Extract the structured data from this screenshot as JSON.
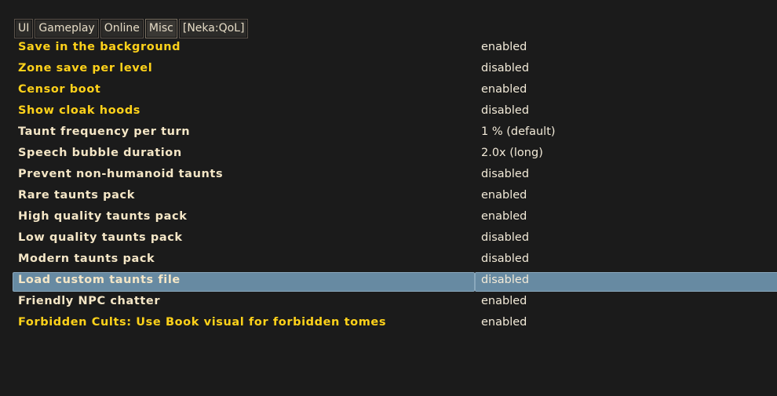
{
  "tabs": [
    {
      "label": "UI"
    },
    {
      "label": "Gameplay"
    },
    {
      "label": "Online"
    },
    {
      "label": "Misc"
    },
    {
      "label": "[Neka:QoL]"
    }
  ],
  "active_tab_index": 3,
  "colors": {
    "background": "#1b1b1b",
    "option_yellow": "#ffd21a",
    "option_cream": "#f4e6c6",
    "value_text": "#f2ead8",
    "selection": "#678aa2"
  },
  "options": [
    {
      "name": "Save in the background",
      "value": "enabled"
    },
    {
      "name": "Zone save per level",
      "value": "disabled"
    },
    {
      "name": "Censor boot",
      "value": "enabled"
    },
    {
      "name": "Show cloak hoods",
      "value": "disabled"
    },
    {
      "name": "Taunt frequency per turn",
      "value": "1 % (default)"
    },
    {
      "name": "Speech bubble duration",
      "value": "2.0x (long)"
    },
    {
      "name": "Prevent non-humanoid taunts",
      "value": "disabled"
    },
    {
      "name": "Rare taunts pack",
      "value": "enabled"
    },
    {
      "name": "High quality taunts pack",
      "value": "enabled"
    },
    {
      "name": "Low quality taunts pack",
      "value": "disabled"
    },
    {
      "name": "Modern taunts pack",
      "value": "disabled"
    },
    {
      "name": "Load custom taunts file",
      "value": "disabled"
    },
    {
      "name": "Friendly NPC chatter",
      "value": "enabled"
    },
    {
      "name": "Forbidden Cults: Use Book visual for forbidden tomes",
      "value": "enabled"
    }
  ],
  "selected_option_index": 11
}
